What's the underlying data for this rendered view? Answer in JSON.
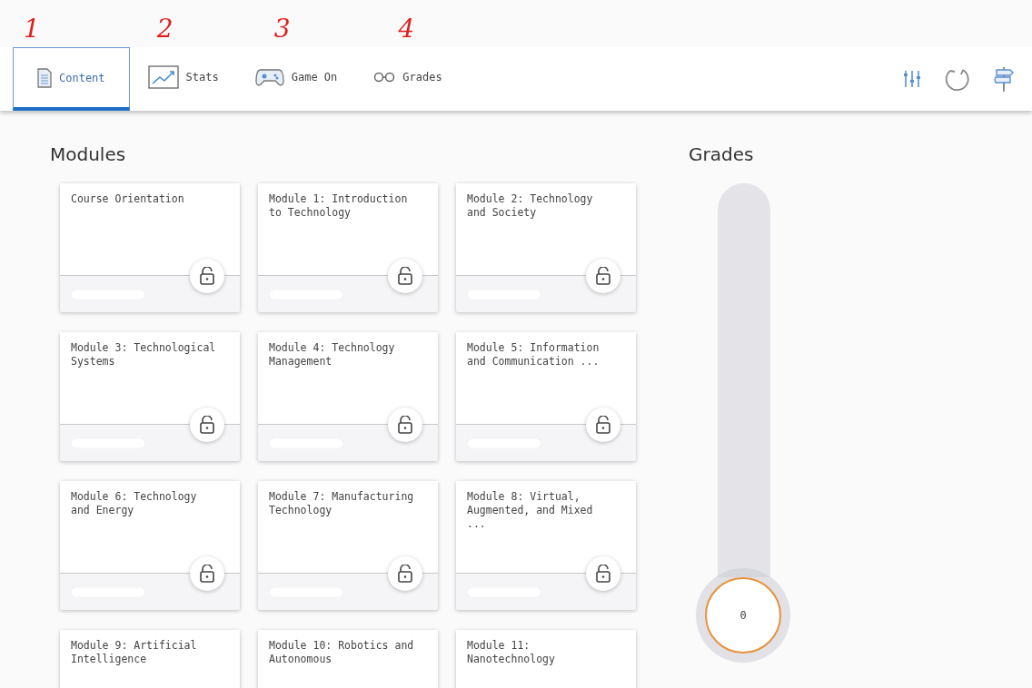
{
  "annotations": [
    "1",
    "2",
    "3",
    "4"
  ],
  "tabs": [
    {
      "label": "Content",
      "selected": true
    },
    {
      "label": "Stats",
      "selected": false
    },
    {
      "label": "Game On",
      "selected": false
    },
    {
      "label": "Grades",
      "selected": false
    }
  ],
  "modules": {
    "title": "Modules",
    "cards": [
      {
        "title": "Course Orientation",
        "level": 0
      },
      {
        "title": "Module 1: Introduction to Technology",
        "level": 0
      },
      {
        "title": "Module 2: Technology and Society",
        "level": 0
      },
      {
        "title": "Module 3: Technological Systems",
        "level": 0
      },
      {
        "title": "Module 4: Technology Management",
        "level": 0
      },
      {
        "title": "Module 5: Information and Communication ...",
        "level": 0
      },
      {
        "title": "Module 6: Technology and Energy",
        "level": 0
      },
      {
        "title": "Module 7: Manufacturing Technology",
        "level": 0
      },
      {
        "title": "Module 8: Virtual, Augmented, and Mixed ...",
        "level": 0
      },
      {
        "title": "Module 9: Artificial Intelligence"
      },
      {
        "title": "Module 10: Robotics and Autonomous"
      },
      {
        "title": "Module 11: Nanotechnology"
      }
    ]
  },
  "grades": {
    "title": "Grades",
    "value": "0"
  }
}
